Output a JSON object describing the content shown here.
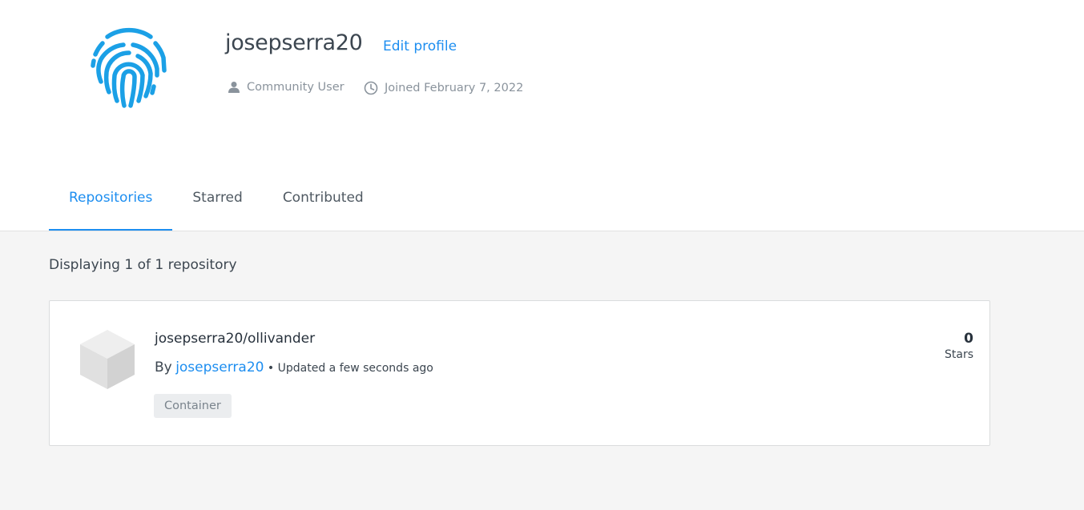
{
  "profile": {
    "username": "josepserra20",
    "edit_label": "Edit profile",
    "role": "Community User",
    "joined": "Joined February 7, 2022",
    "avatar_icon": "fingerprint-icon",
    "accent_color": "#1d8ef0"
  },
  "tabs": [
    {
      "label": "Repositories",
      "active": true
    },
    {
      "label": "Starred",
      "active": false
    },
    {
      "label": "Contributed",
      "active": false
    }
  ],
  "listing": {
    "count_text": "Displaying 1 of 1 repository",
    "repos": [
      {
        "name": "josepserra20/ollivander",
        "by_label": "By",
        "owner": "josepserra20",
        "updated": "• Updated a few seconds ago",
        "tag": "Container",
        "stars": "0",
        "stars_label": "Stars",
        "icon": "cube-icon"
      }
    ]
  }
}
